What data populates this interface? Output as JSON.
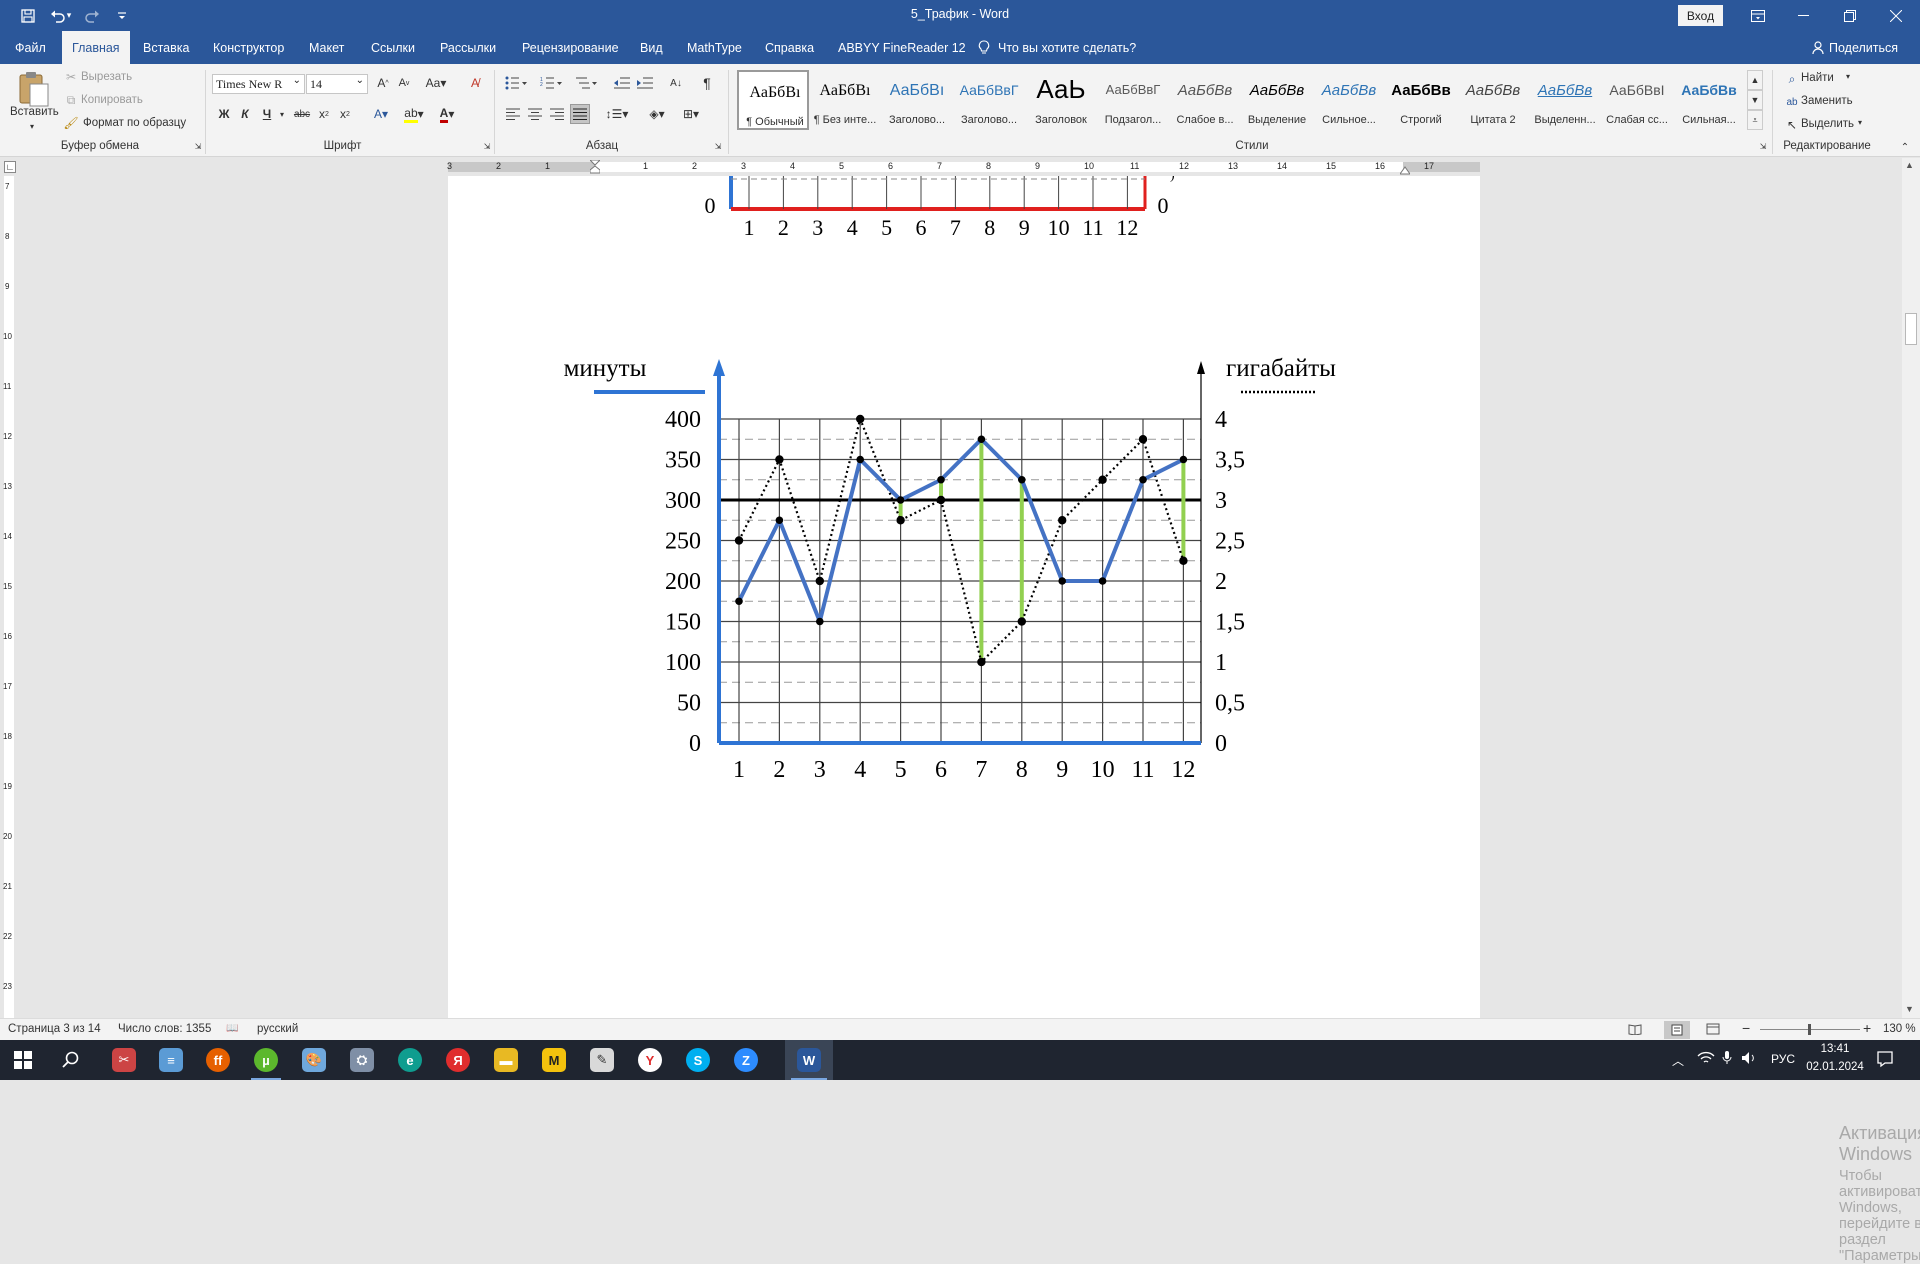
{
  "titlebar": {
    "doc_title": "5_Трафик  -  Word",
    "login": "Вход",
    "icons": [
      "save-icon",
      "undo-icon",
      "redo-icon",
      "customize-icon",
      "ribbon-display-icon",
      "minimize-icon",
      "restore-icon",
      "close-icon"
    ]
  },
  "tabs": [
    "Файл",
    "Главная",
    "Вставка",
    "Конструктор",
    "Макет",
    "Ссылки",
    "Рассылки",
    "Рецензирование",
    "Вид",
    "MathType",
    "Справка",
    "ABBYY FineReader 12"
  ],
  "tell_me": "Что вы хотите сделать?",
  "share": "Поделиться",
  "clipboard": {
    "paste": "Вставить",
    "cut": "Вырезать",
    "copy": "Копировать",
    "format_painter": "Формат по образцу",
    "label": "Буфер обмена"
  },
  "font": {
    "name": "Times New R",
    "size": "14",
    "label": "Шрифт",
    "bold": "Ж",
    "italic": "К",
    "underline": "Ч"
  },
  "paragraph": {
    "label": "Абзац"
  },
  "styles": {
    "label": "Стили",
    "items": [
      {
        "sample": "АаБбВı",
        "name": "¶ Обычный"
      },
      {
        "sample": "АаБбВı",
        "name": "¶ Без инте..."
      },
      {
        "sample": "АаБбВı",
        "name": "Заголово..."
      },
      {
        "sample": "АаБбВвГ",
        "name": "Заголово..."
      },
      {
        "sample": "АаЬ",
        "name": "Заголовок"
      },
      {
        "sample": "АаБбВвГ",
        "name": "Подзагол..."
      },
      {
        "sample": "АаБбВв",
        "name": "Слабое в..."
      },
      {
        "sample": "АаБбВв",
        "name": "Выделение"
      },
      {
        "sample": "АаБбВв",
        "name": "Сильное..."
      },
      {
        "sample": "АаБбВв",
        "name": "Строгий"
      },
      {
        "sample": "АаБбВв",
        "name": "Цитата 2"
      },
      {
        "sample": "АаБбВв",
        "name": "Выделенн..."
      },
      {
        "sample": "АаБбВвI",
        "name": "Слабая сс..."
      },
      {
        "sample": "АаБбВв",
        "name": "Сильная..."
      }
    ]
  },
  "editing": {
    "label": "Редактирование",
    "find": "Найти",
    "replace": "Заменить",
    "select": "Выделить"
  },
  "ruler": {
    "h_labels": [
      "3",
      "2",
      "1",
      "1",
      "2",
      "3",
      "4",
      "5",
      "6",
      "7",
      "8",
      "9",
      "10",
      "11",
      "12",
      "13",
      "14",
      "15",
      "16",
      "17"
    ],
    "v_labels": [
      "7",
      "8",
      "9",
      "10",
      "11",
      "12",
      "13",
      "14",
      "15",
      "16",
      "17",
      "18",
      "19",
      "20",
      "21",
      "22",
      "23"
    ]
  },
  "top_chart_fragment": {
    "left_zero": "0",
    "right_zero": "0",
    "x_labels": [
      "1",
      "2",
      "3",
      "4",
      "5",
      "6",
      "7",
      "8",
      "9",
      "10",
      "11",
      "12"
    ]
  },
  "chart_data": {
    "type": "line",
    "left_axis_title": "минуты",
    "right_axis_title": "гигабайты",
    "categories": [
      "1",
      "2",
      "3",
      "4",
      "5",
      "6",
      "7",
      "8",
      "9",
      "10",
      "11",
      "12"
    ],
    "left_ticks": [
      "0",
      "50",
      "100",
      "150",
      "200",
      "250",
      "300",
      "350",
      "400"
    ],
    "right_ticks": [
      "0",
      "0,5",
      "1",
      "1,5",
      "2",
      "2,5",
      "3",
      "3,5",
      "4"
    ],
    "ylim_left": [
      0,
      400
    ],
    "ylim_right": [
      0,
      4
    ],
    "threshold_left": 300,
    "grid": true,
    "series": [
      {
        "axis": "left",
        "style": "solid",
        "color": "#4472c4",
        "values": [
          175,
          275,
          150,
          350,
          300,
          325,
          375,
          325,
          200,
          200,
          325,
          350
        ]
      },
      {
        "axis": "right",
        "style": "dotted",
        "color": "#000000",
        "values": [
          2.5,
          3.5,
          2.0,
          4.0,
          2.75,
          3.0,
          1.0,
          1.5,
          2.75,
          3.25,
          3.75,
          2.25
        ]
      }
    ],
    "highlight_color": "#92d050"
  },
  "watermark": {
    "line1": "Активация Windows",
    "line2": "Чтобы активировать Windows, перейдите в раздел \"Параметры\"."
  },
  "status": {
    "page": "Страница 3 из 14",
    "words": "Число слов: 1355",
    "language": "русский",
    "zoom": "130 %"
  },
  "taskbar": {
    "lang": "РУС",
    "time": "13:41",
    "date": "02.01.2024"
  }
}
